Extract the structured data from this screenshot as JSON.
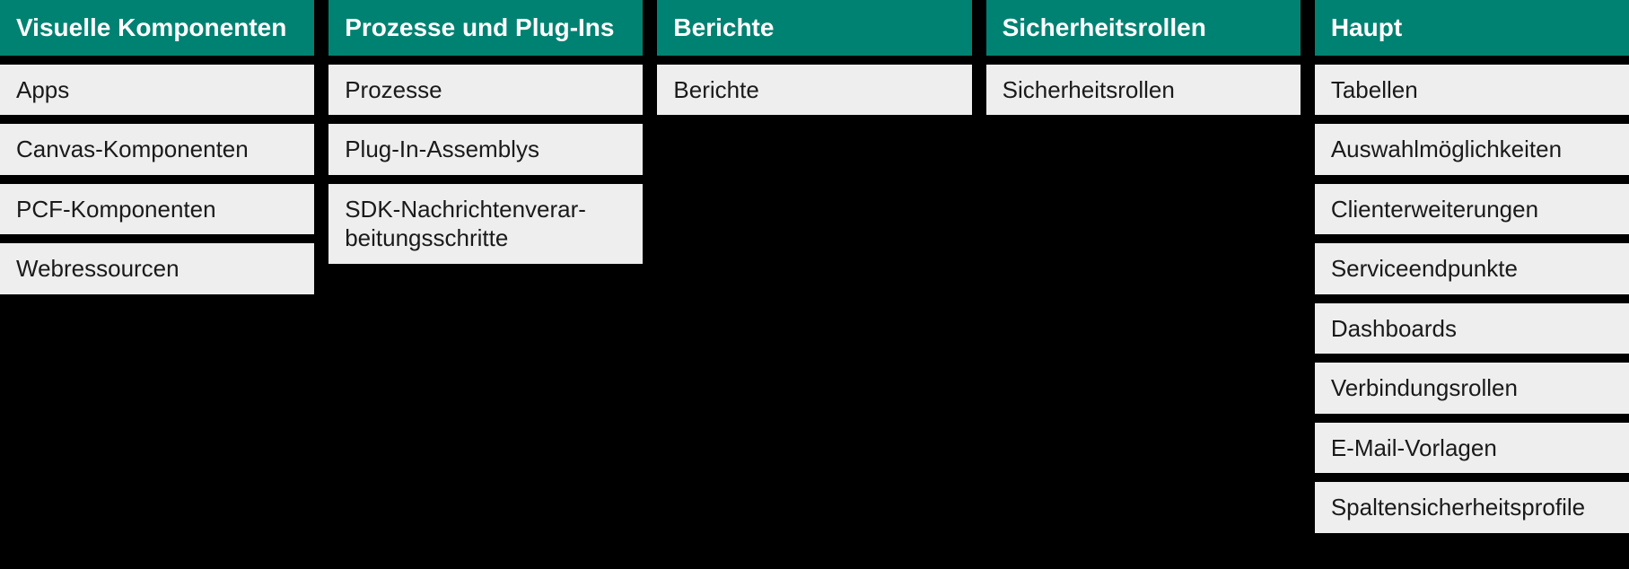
{
  "columns": [
    {
      "header": "Visuelle Komponenten",
      "items": [
        "Apps",
        "Canvas-Komponenten",
        "PCF-Komponenten",
        "Webressourcen"
      ]
    },
    {
      "header": "Prozesse und Plug-Ins",
      "items": [
        "Prozesse",
        "Plug-In-Assemblys",
        "SDK-Nachrichtenverar­beitungsschritte"
      ]
    },
    {
      "header": "Berichte",
      "items": [
        "Berichte"
      ]
    },
    {
      "header": "Sicherheitsrollen",
      "items": [
        "Sicherheitsrollen"
      ]
    },
    {
      "header": "Haupt",
      "items": [
        "Tabellen",
        "Auswahlmöglichkeiten",
        "Clienterweiterungen",
        "Serviceendpunkte",
        "Dashboards",
        "Verbindungsrollen",
        "E-Mail-Vorlagen",
        "Spaltensicherheitsprofile"
      ]
    }
  ]
}
